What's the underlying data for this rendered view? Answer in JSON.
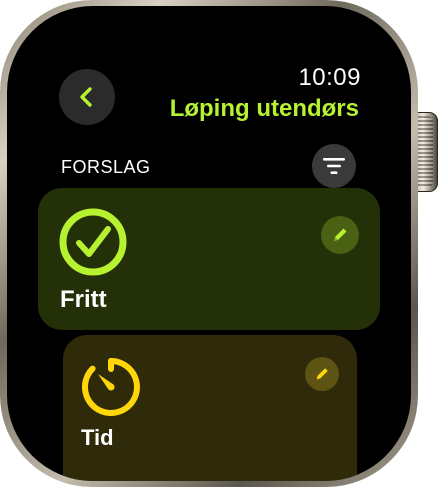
{
  "status": {
    "time": "10:09"
  },
  "header": {
    "title": "Løping utendørs",
    "back_icon": "chevron-left-icon"
  },
  "section": {
    "label": "FORSLAG",
    "filter_icon": "filter-icon"
  },
  "cards": [
    {
      "label": "Fritt",
      "icon": "checkmark-ring-icon",
      "edit_icon": "pencil-icon",
      "accent": "#b6f230"
    },
    {
      "label": "Tid",
      "icon": "timer-icon",
      "edit_icon": "pencil-icon",
      "accent": "#ffd60a"
    }
  ],
  "colors": {
    "accent_green": "#b6f230",
    "accent_yellow": "#ffd60a",
    "background": "#000000"
  }
}
